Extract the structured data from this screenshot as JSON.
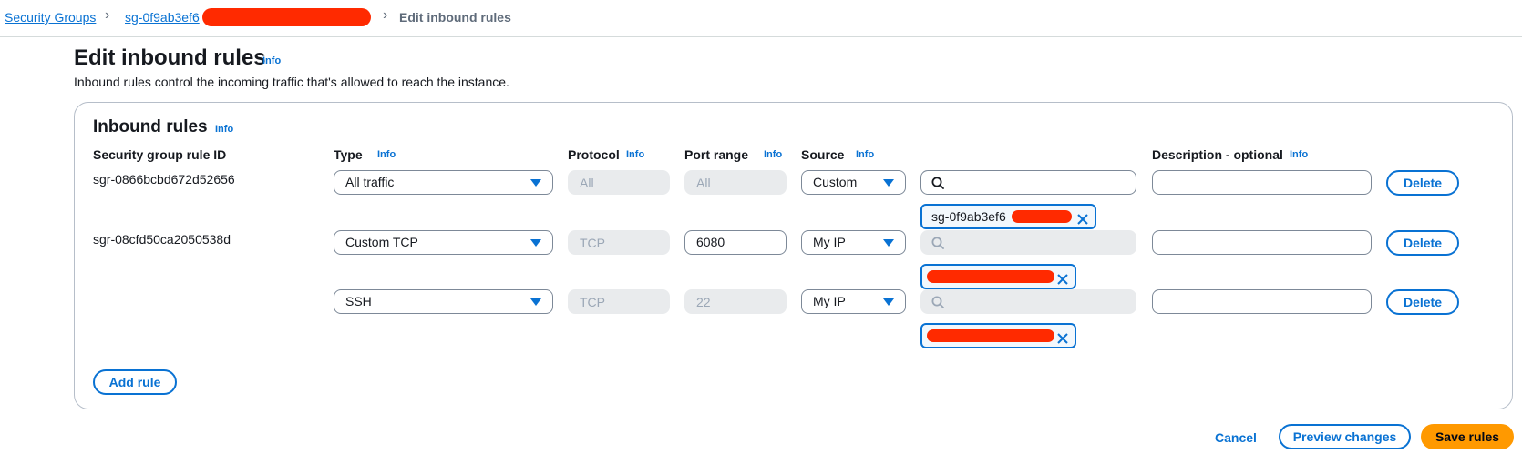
{
  "breadcrumb": {
    "root": "Security Groups",
    "group": "sg-0f9ab3ef6",
    "current": "Edit inbound rules"
  },
  "page": {
    "title": "Edit inbound rules",
    "info": "Info",
    "description": "Inbound rules control the incoming traffic that's allowed to reach the instance."
  },
  "panel": {
    "title": "Inbound rules",
    "info": "Info",
    "columns": {
      "rule_id": "Security group rule ID",
      "type": "Type",
      "protocol": "Protocol",
      "port_range": "Port range",
      "source": "Source",
      "description": "Description - optional",
      "info": "Info"
    }
  },
  "rules": [
    {
      "id": "sgr-0866bcbd672d52656",
      "type": "All traffic",
      "protocol": "All",
      "port": "All",
      "source": "Custom",
      "search": "",
      "token": "sg-0f9ab3ef6",
      "description": "",
      "delete": "Delete"
    },
    {
      "id": "sgr-08cfd50ca2050538d",
      "type": "Custom TCP",
      "protocol": "TCP",
      "port": "6080",
      "source": "My IP",
      "search": "",
      "token": "",
      "description": "",
      "delete": "Delete"
    },
    {
      "id": "–",
      "type": "SSH",
      "protocol": "TCP",
      "port": "22",
      "source": "My IP",
      "search": "",
      "token": "",
      "description": "",
      "delete": "Delete"
    }
  ],
  "actions": {
    "add_rule": "Add rule",
    "cancel": "Cancel",
    "preview": "Preview changes",
    "save": "Save rules"
  },
  "colors": {
    "link": "#0972d3",
    "primary": "#ff9900",
    "redaction": "#ff2a00"
  }
}
